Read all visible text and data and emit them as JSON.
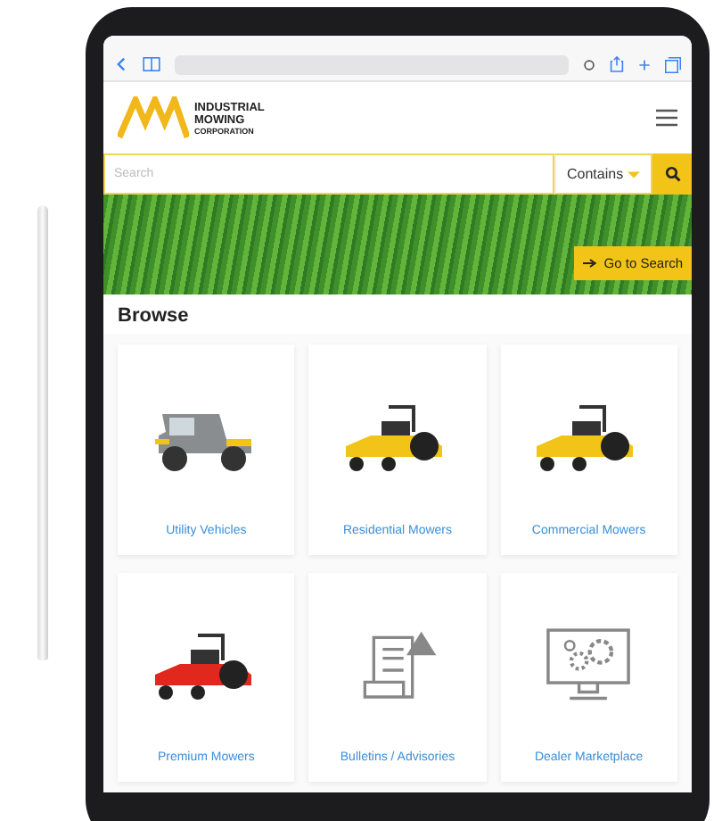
{
  "header": {
    "logo_lines": [
      "INDUSTRIAL",
      "MOWING",
      "CORPORATION"
    ]
  },
  "search": {
    "placeholder": "Search",
    "match_mode": "Contains"
  },
  "hero": {
    "button": "Go to Search"
  },
  "browse": {
    "title": "Browse",
    "cards": [
      {
        "label": "Utility Vehicles",
        "kind": "vehicle"
      },
      {
        "label": "Residential Mowers",
        "kind": "mower",
        "color": "#f2c417"
      },
      {
        "label": "Commercial Mowers",
        "kind": "mower",
        "color": "#f2c417"
      },
      {
        "label": "Premium Mowers",
        "kind": "mower",
        "color": "#e0281e"
      },
      {
        "label": "Bulletins / Advisories",
        "kind": "bulletin"
      },
      {
        "label": "Dealer Marketplace",
        "kind": "monitor"
      }
    ]
  }
}
